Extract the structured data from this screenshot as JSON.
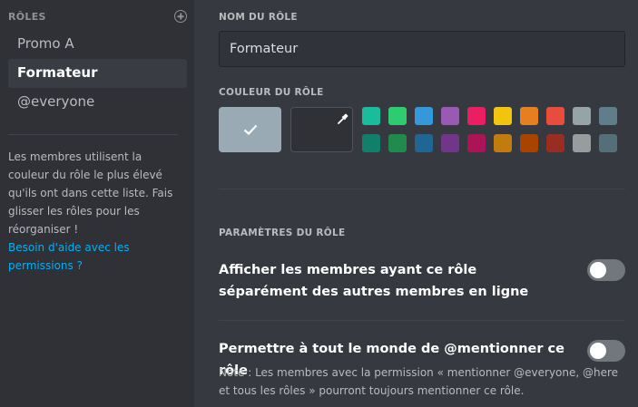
{
  "sidebar": {
    "header": "RÔLES",
    "add_icon": "plus-circle-icon",
    "roles": [
      {
        "label": "Promo A",
        "active": false
      },
      {
        "label": "Formateur",
        "active": true
      },
      {
        "label": "@everyone",
        "active": false
      }
    ],
    "help_text": "Les membres utilisent la couleur du rôle le plus élevé qu'ils ont dans cette liste. Fais glisser les rôles pour les réorganiser !",
    "help_link": "Besoin d'aide avec les permissions ?"
  },
  "main": {
    "name_label": "NOM DU RÔLE",
    "name_value": "Formateur",
    "color_label": "COULEUR DU RÔLE",
    "default_color": "#99aab5",
    "default_color_icon": "check-icon",
    "custom_color_icon": "eyedropper-icon",
    "palette": [
      "#1abc9c",
      "#2ecc71",
      "#3498db",
      "#9b59b6",
      "#e91e63",
      "#f1c40f",
      "#e67e22",
      "#e74c3c",
      "#95a5a6",
      "#607d8b",
      "#11806a",
      "#1f8b4c",
      "#206694",
      "#71368a",
      "#ad1457",
      "#c27c0e",
      "#a84300",
      "#992d22",
      "#979c9f",
      "#546e7a"
    ],
    "settings_label": "PARAMÈTRES DU RÔLE",
    "settings": [
      {
        "label": "Afficher les membres ayant ce rôle séparément des autres membres en ligne",
        "enabled": false
      },
      {
        "label": "Permettre à tout le monde de @mentionner ce rôle",
        "enabled": false
      }
    ],
    "note": "Note : Les membres avec la permission « mentionner @everyone, @here et tous les rôles » pourront toujours mentionner ce rôle."
  }
}
